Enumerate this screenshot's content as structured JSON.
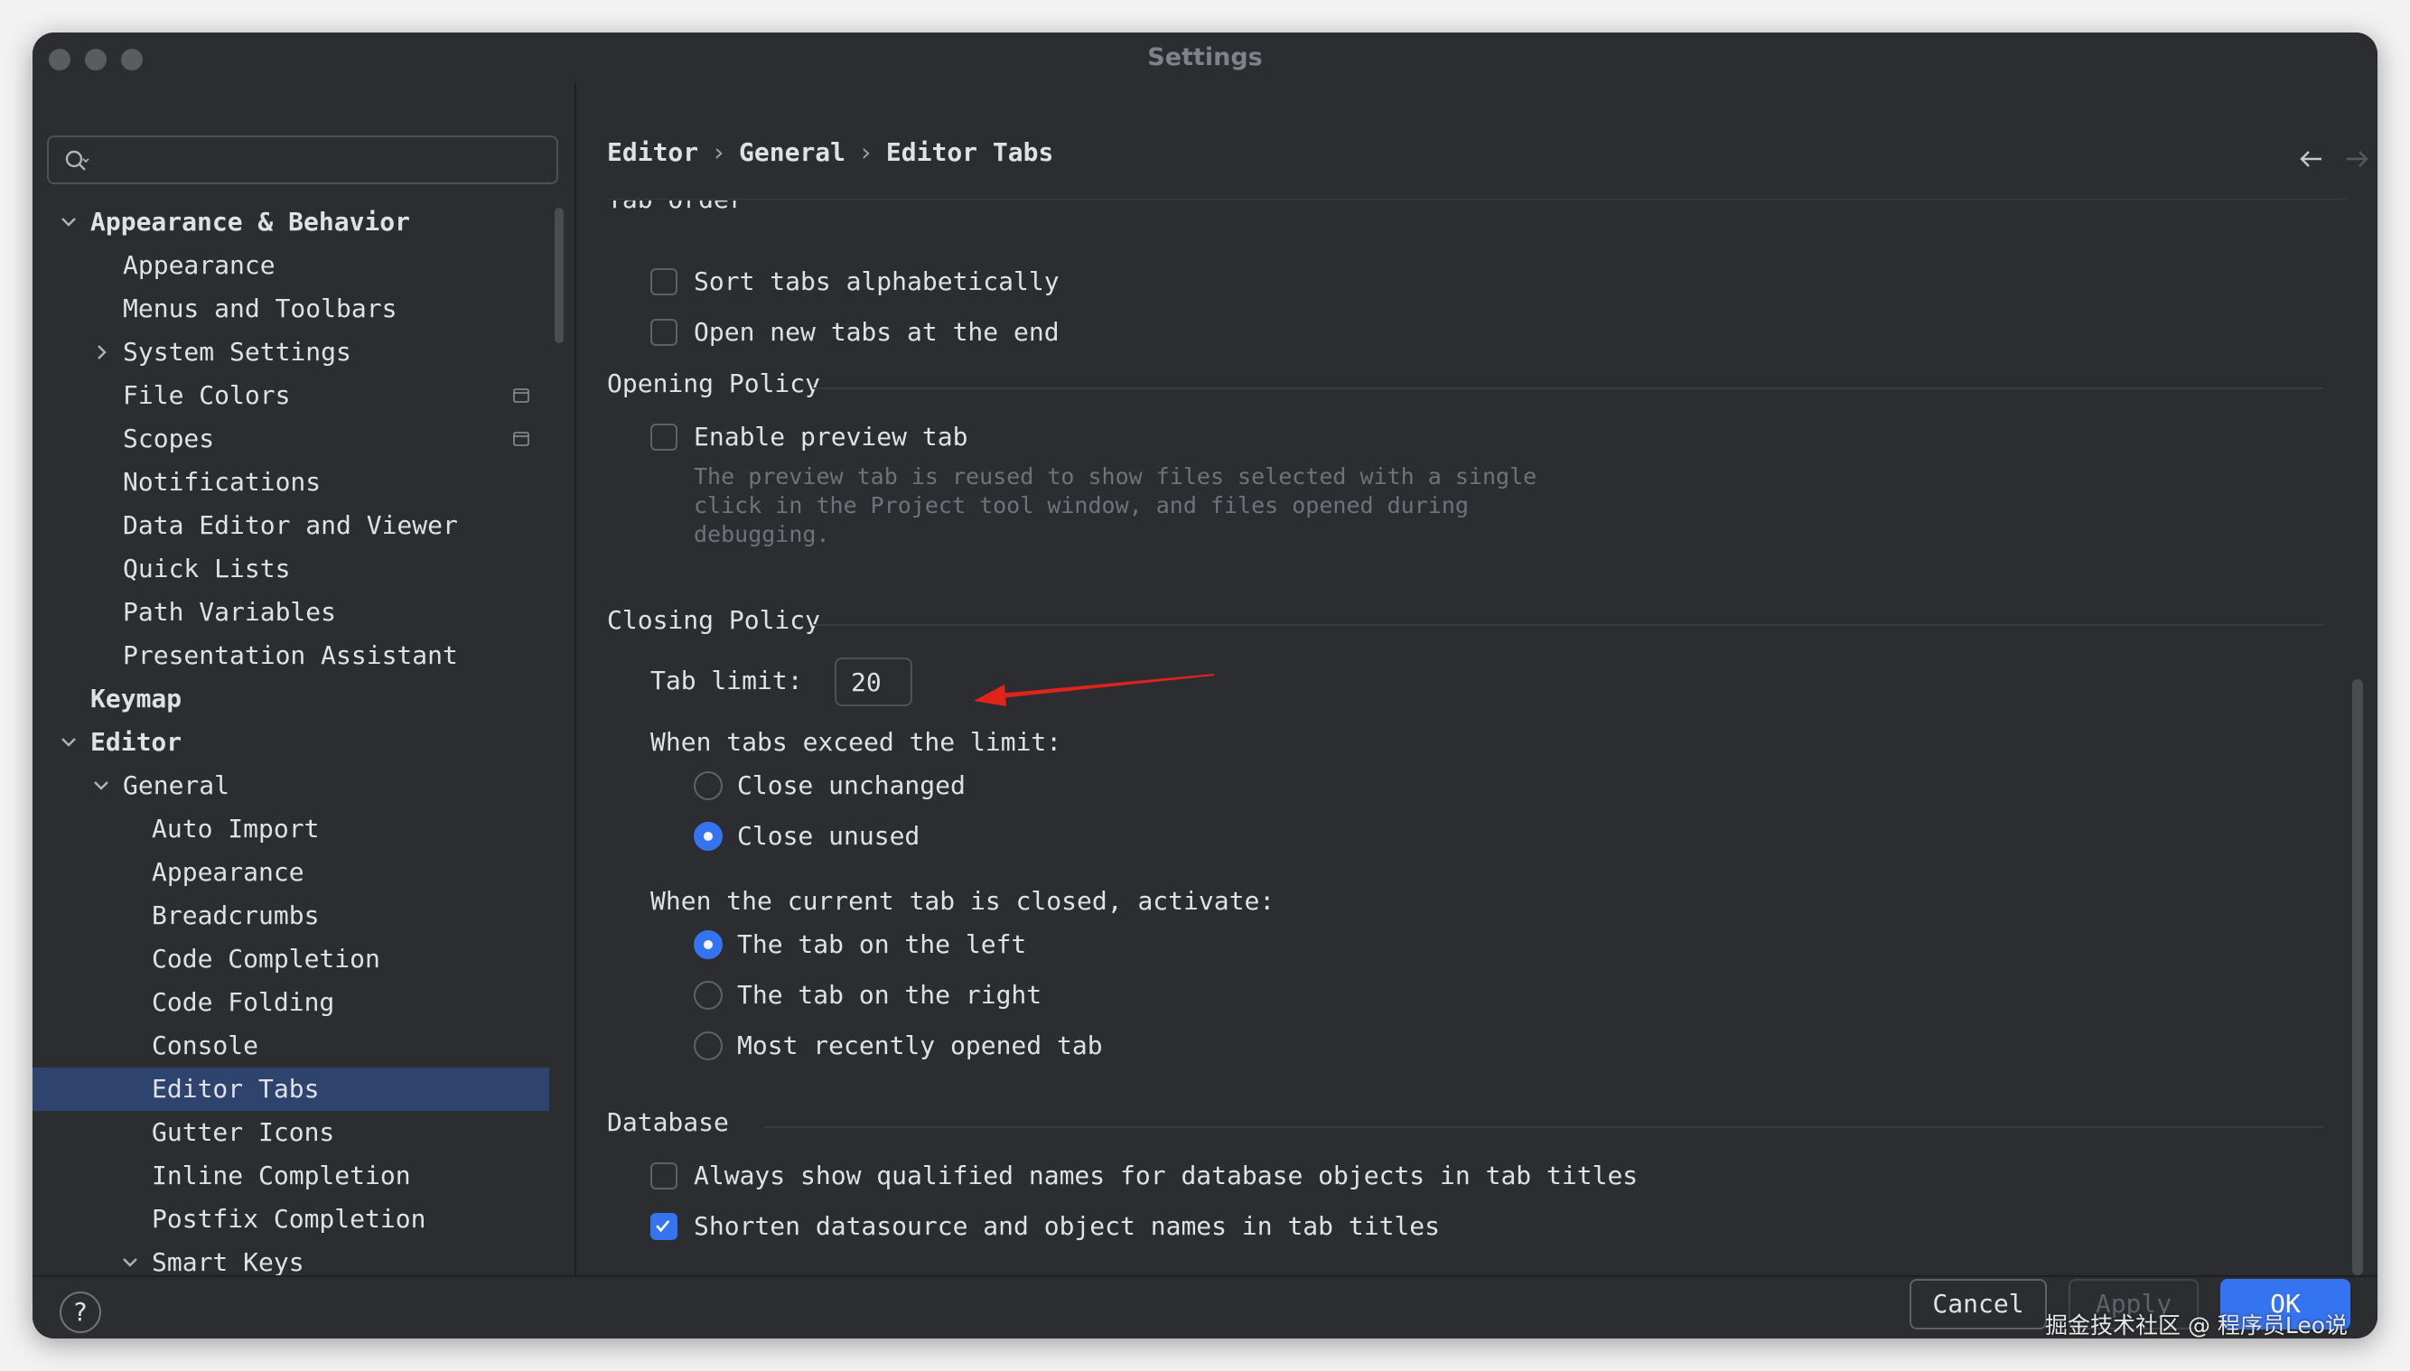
{
  "window": {
    "title": "Settings"
  },
  "search": {
    "placeholder": ""
  },
  "sidebar": {
    "items": [
      {
        "label": "Appearance & Behavior",
        "bold": true,
        "chevron": "down",
        "indent": 0
      },
      {
        "label": "Appearance",
        "indent": 1
      },
      {
        "label": "Menus and Toolbars",
        "indent": 1
      },
      {
        "label": "System Settings",
        "chevron": "right",
        "indent": 1
      },
      {
        "label": "File Colors",
        "indent": 1,
        "badge": true
      },
      {
        "label": "Scopes",
        "indent": 1,
        "badge": true
      },
      {
        "label": "Notifications",
        "indent": 1
      },
      {
        "label": "Data Editor and Viewer",
        "indent": 1
      },
      {
        "label": "Quick Lists",
        "indent": 1
      },
      {
        "label": "Path Variables",
        "indent": 1
      },
      {
        "label": "Presentation Assistant",
        "indent": 1
      },
      {
        "label": "Keymap",
        "bold": true,
        "indent": 0
      },
      {
        "label": "Editor",
        "bold": true,
        "chevron": "down",
        "indent": 0
      },
      {
        "label": "General",
        "chevron": "down",
        "indent": 1
      },
      {
        "label": "Auto Import",
        "indent": 2
      },
      {
        "label": "Appearance",
        "indent": 2
      },
      {
        "label": "Breadcrumbs",
        "indent": 2
      },
      {
        "label": "Code Completion",
        "indent": 2
      },
      {
        "label": "Code Folding",
        "indent": 2
      },
      {
        "label": "Console",
        "indent": 2
      },
      {
        "label": "Editor Tabs",
        "indent": 2,
        "selected": true
      },
      {
        "label": "Gutter Icons",
        "indent": 2
      },
      {
        "label": "Inline Completion",
        "indent": 2
      },
      {
        "label": "Postfix Completion",
        "indent": 2
      },
      {
        "label": "Smart Keys",
        "chevron": "down",
        "indent": 2
      }
    ]
  },
  "breadcrumb": {
    "part1": "Editor",
    "part2": "General",
    "part3": "Editor Tabs",
    "separator": "›"
  },
  "sections": {
    "tab_order": {
      "title": "Tab Order",
      "sort_alphabetically": "Sort tabs alphabetically",
      "open_at_end": "Open new tabs at the end"
    },
    "opening_policy": {
      "title": "Opening Policy",
      "enable_preview": "Enable preview tab",
      "preview_desc_1": "The preview tab is reused to show files selected with a single",
      "preview_desc_2": "click in the Project tool window, and files opened during",
      "preview_desc_3": "debugging."
    },
    "closing_policy": {
      "title": "Closing Policy",
      "tab_limit_label": "Tab limit:",
      "tab_limit_value": "20",
      "exceed_label": "When tabs exceed the limit:",
      "close_unchanged": "Close unchanged",
      "close_unused": "Close unused",
      "activate_label": "When the current tab is closed, activate:",
      "tab_left": "The tab on the left",
      "tab_right": "The tab on the right",
      "most_recent": "Most recently opened tab"
    },
    "database": {
      "title": "Database",
      "qualified_names": "Always show qualified names for database objects in tab titles",
      "shorten_names": "Shorten datasource and object names in tab titles"
    }
  },
  "state": {
    "sort_alphabetically": false,
    "open_at_end": false,
    "enable_preview": false,
    "exceed_choice": "close_unused",
    "activate_choice": "tab_left",
    "qualified_names": false,
    "shorten_names": true
  },
  "footer": {
    "help": "?",
    "cancel": "Cancel",
    "apply": "Apply",
    "ok": "OK"
  },
  "watermark": "掘金技术社区 @ 程序员Leo说",
  "colors": {
    "accent": "#3574f0",
    "selection": "#2e436e",
    "background": "#2b2d30",
    "annotation_arrow": "#e0241b"
  }
}
